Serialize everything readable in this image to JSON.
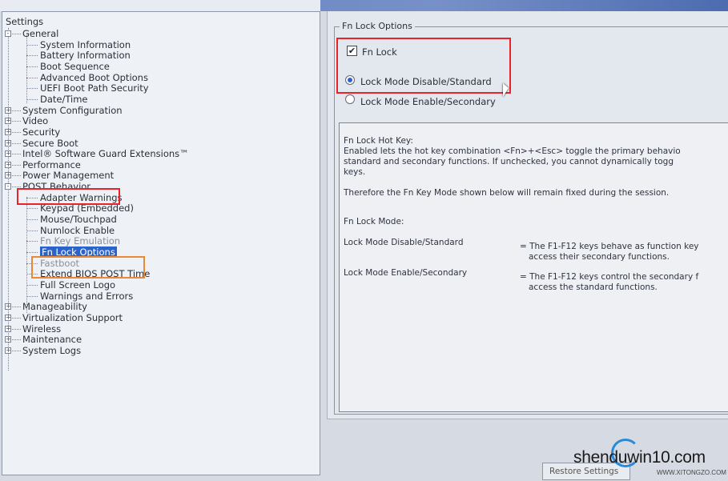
{
  "tree": {
    "root": "Settings",
    "items": [
      {
        "label": "General",
        "level": 1,
        "expander": "-"
      },
      {
        "label": "System Information",
        "level": 2
      },
      {
        "label": "Battery Information",
        "level": 2
      },
      {
        "label": "Boot Sequence",
        "level": 2
      },
      {
        "label": "Advanced Boot Options",
        "level": 2
      },
      {
        "label": "UEFI Boot Path Security",
        "level": 2
      },
      {
        "label": "Date/Time",
        "level": 2
      },
      {
        "label": "System Configuration",
        "level": 1,
        "expander": "+"
      },
      {
        "label": "Video",
        "level": 1,
        "expander": "+"
      },
      {
        "label": "Security",
        "level": 1,
        "expander": "+"
      },
      {
        "label": "Secure Boot",
        "level": 1,
        "expander": "+"
      },
      {
        "label": "Intel® Software Guard Extensions™",
        "level": 1,
        "expander": "+"
      },
      {
        "label": "Performance",
        "level": 1,
        "expander": "+"
      },
      {
        "label": "Power Management",
        "level": 1,
        "expander": "+"
      },
      {
        "label": "POST Behavior",
        "level": 1,
        "expander": "-"
      },
      {
        "label": "Adapter Warnings",
        "level": 2
      },
      {
        "label": "Keypad (Embedded)",
        "level": 2
      },
      {
        "label": "Mouse/Touchpad",
        "level": 2
      },
      {
        "label": "Numlock Enable",
        "level": 2
      },
      {
        "label": "Fn Key Emulation",
        "level": 2
      },
      {
        "label": "Fn Lock Options",
        "level": 2,
        "selected": true
      },
      {
        "label": "Fastboot",
        "level": 2
      },
      {
        "label": "Extend BIOS POST Time",
        "level": 2
      },
      {
        "label": "Full Screen Logo",
        "level": 2
      },
      {
        "label": "Warnings and Errors",
        "level": 2
      },
      {
        "label": "Manageability",
        "level": 1,
        "expander": "+"
      },
      {
        "label": "Virtualization Support",
        "level": 1,
        "expander": "+"
      },
      {
        "label": "Wireless",
        "level": 1,
        "expander": "+"
      },
      {
        "label": "Maintenance",
        "level": 1,
        "expander": "+"
      },
      {
        "label": "System Logs",
        "level": 1,
        "expander": "+"
      }
    ]
  },
  "panel": {
    "group_title": "Fn Lock Options",
    "fn_lock_label": "Fn Lock",
    "fn_lock_checked": true,
    "radio_options": [
      {
        "label": "Lock Mode Disable/Standard",
        "selected": true
      },
      {
        "label": "Lock Mode Enable/Secondary",
        "selected": false
      }
    ]
  },
  "help": {
    "heading": "Fn Lock Hot Key:",
    "line1": "Enabled lets the hot key combination <Fn>+<Esc> toggle the primary behavio",
    "line2": "standard and secondary functions. If unchecked, you cannot dynamically togg",
    "line3": "keys.",
    "line4": "Therefore the Fn Key Mode shown below will remain fixed during the session.",
    "line5": "Fn Lock Mode:",
    "mode1_name": "Lock Mode Disable/Standard",
    "mode1_desc1": "= The F1-F12 keys behave as function key",
    "mode1_desc2": "access their secondary functions.",
    "mode2_name": "Lock Mode Enable/Secondary",
    "mode2_desc1": "= The F1-F12 keys control the secondary f",
    "mode2_desc2": "access the standard functions."
  },
  "footer": {
    "restore_label": "Restore Settings"
  },
  "watermark": {
    "text": "shenduwin10.com",
    "small": "WWW.XITONGZO.COM"
  },
  "colors": {
    "selection": "#2c63c9",
    "highlight_red": "#e8232a",
    "highlight_orange": "#e88a35"
  }
}
